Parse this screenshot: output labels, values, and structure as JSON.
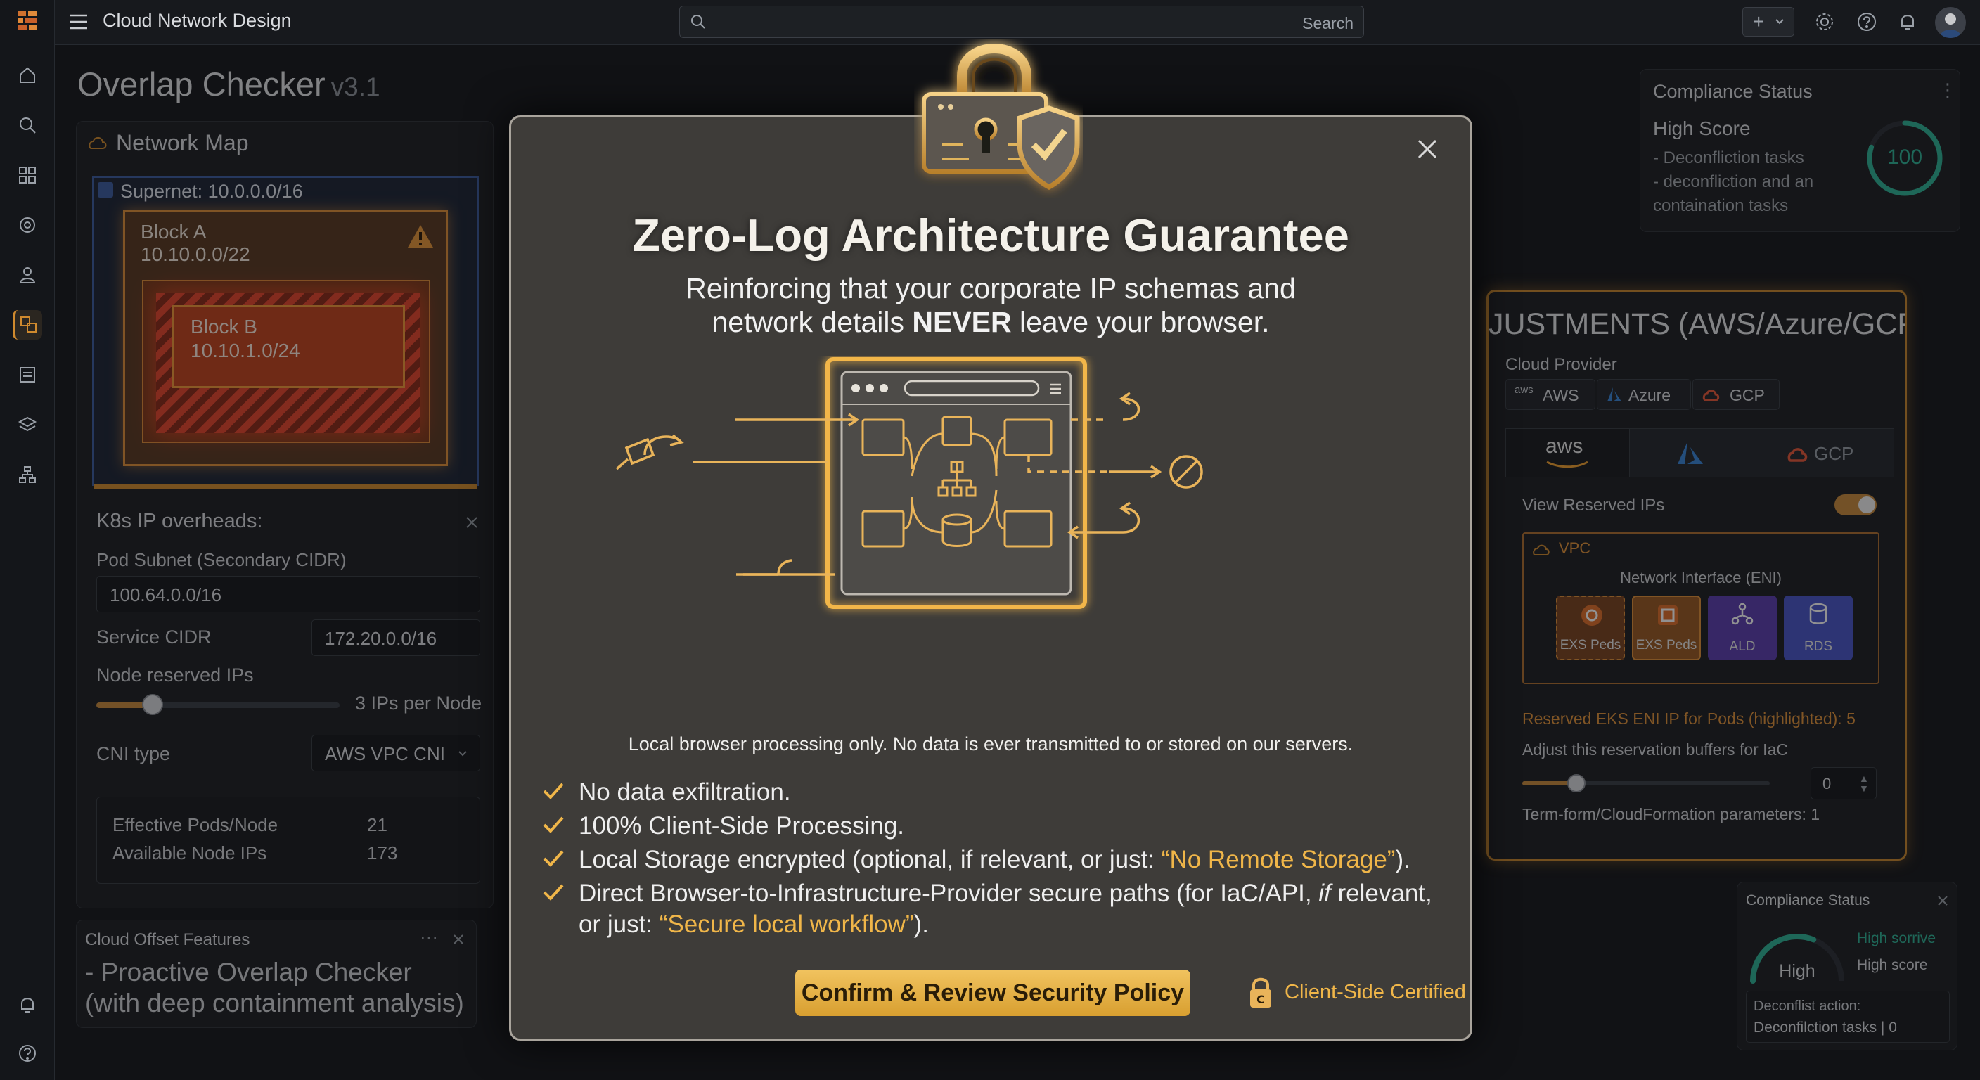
{
  "app": {
    "title": "Cloud Network Design"
  },
  "search": {
    "label": "Search"
  },
  "topbar": {
    "add_label": "+"
  },
  "page": {
    "title": "Overlap Checker",
    "version": "v3.1"
  },
  "network_map": {
    "title": "Network Map",
    "supernet": "Supernet: 10.0.0.0/16",
    "block_a": {
      "name": "Block A",
      "cidr": "10.10.0.0/22"
    },
    "block_b": {
      "name": "Block B",
      "cidr": "10.10.1.0/24"
    }
  },
  "k8s": {
    "title": "K8s IP overheads:",
    "pod_subnet_label": "Pod Subnet (Secondary CIDR)",
    "pod_subnet_value": "100.64.0.0/16",
    "service_cidr_label": "Service CIDR",
    "service_cidr_value": "172.20.0.0/16",
    "node_reserved_label": "Node reserved IPs",
    "node_reserved_value": "3 IPs per Node",
    "node_reserved_slider": 0.23,
    "cni_label": "CNI type",
    "cni_value": "AWS VPC CNI",
    "effective_pods_label": "Effective Pods/Node",
    "effective_pods_value": "21",
    "available_ips_label": "Available Node IPs",
    "available_ips_value": "173"
  },
  "offset_features": {
    "title": "Cloud Offset Features",
    "more": "···",
    "text": "- Proactive Overlap Checker (with deep containment analysis)"
  },
  "compliance_top": {
    "title": "Compliance Status",
    "score_label": "High Score",
    "line1": "- Deconfliction tasks",
    "line2": "- deconfliction and an",
    "line3": "containation tasks",
    "score": "100",
    "score_fraction": 0.8
  },
  "adjustments": {
    "title": "JUSTMENTS (AWS/Azure/GCP)",
    "provider_label": "Cloud Provider",
    "providers": [
      "AWS",
      "Azure",
      "GCP"
    ],
    "aws_small": "aws",
    "tab_aws": "aws",
    "tab_gcp": "GCP",
    "reserved_toggle_label": "View Reserved IPs",
    "vpc_label": "VPC",
    "eni_label": "Network Interface (ENI)",
    "tiles": [
      "EXS Peds",
      "EXS Peds",
      "ALD",
      "RDS"
    ],
    "reserved_eks": "Reserved EKS ENI IP for Pods (highlighted): 5",
    "adjust_label": "Adjust this reservation buffers for IaC",
    "adjust_slider": 0.22,
    "adjust_value": "0",
    "terraform_label": "Term-form/CloudFormation parameters: 1"
  },
  "compliance_bottom": {
    "title": "Compliance Status",
    "gauge_label": "High",
    "line1": "High sorrive",
    "line2": "High score",
    "action_label": "Deconflist action:",
    "action_value": "Deconfilction tasks | 0",
    "gauge_fraction": 0.62
  },
  "modal": {
    "title": "Zero-Log Architecture Guarantee",
    "subtitle_line1": "Reinforcing that your corporate IP schemas and",
    "subtitle_pre": "network details ",
    "subtitle_strong": "NEVER",
    "subtitle_post": " leave your browser.",
    "caption": "Local browser processing only. No data is ever transmitted to or stored on our servers.",
    "point1": "No data exfiltration.",
    "point2": "100% Client-Side Processing.",
    "point3_pre": "Local Storage encrypted (optional, if relevant, or just: ",
    "point3_quote": "“No Remote Storage”",
    "point3_post": ").",
    "point4_line1_pre": "Direct Browser-to-Infrastructure-Provider secure paths (for IaC/API, ",
    "point4_line1_em": "if",
    "point4_line1_post": " relevant,",
    "point4_line2_pre": "or just: ",
    "point4_line2_quote": "“Secure local workflow”",
    "point4_line2_post": ").",
    "confirm_label": "Confirm & Review Security Policy",
    "certified_label": "Client-Side Certified"
  },
  "colors": {
    "accent": "#d08a2e",
    "gold": "#f0b649",
    "warning": "#e6963a",
    "danger": "#d9482e",
    "teal": "#2fb296"
  },
  "icons": [
    "brand-logo-icon",
    "menu-icon",
    "search-icon",
    "plus-icon",
    "gear-icon",
    "help-icon",
    "bell-icon",
    "avatar",
    "home-icon",
    "grid-icon",
    "network-icon",
    "user-icon",
    "document-icon",
    "layers-icon",
    "diagram-icon",
    "close-icon",
    "padlock-shield-icon",
    "check-icon",
    "lock-c-icon"
  ]
}
